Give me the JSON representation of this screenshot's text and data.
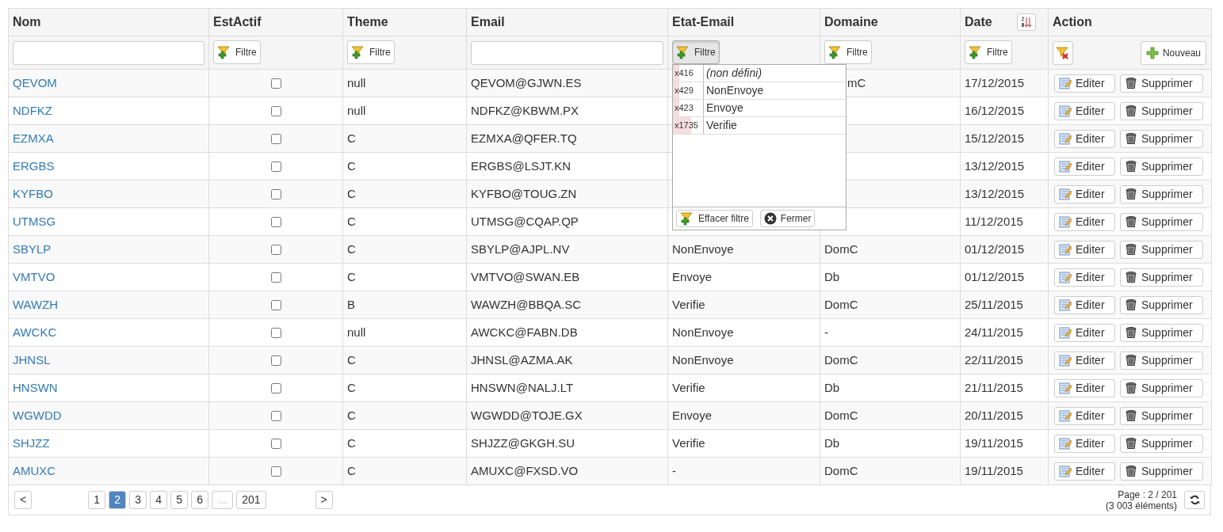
{
  "columns": [
    {
      "kind": "plain",
      "label": "Nom"
    },
    {
      "kind": "plain",
      "label": "EstActif"
    },
    {
      "kind": "plain",
      "label": "Theme"
    },
    {
      "kind": "plain",
      "label": "Email"
    },
    {
      "kind": "plain",
      "label": "Etat-Email"
    },
    {
      "kind": "plain",
      "label": "Domaine"
    },
    {
      "kind": "sortable",
      "label": "Date"
    },
    {
      "kind": "plain",
      "label": "Action"
    }
  ],
  "filters": [
    {
      "kind": "input"
    },
    {
      "kind": "button",
      "label": "Filtre",
      "active": false
    },
    {
      "kind": "button",
      "label": "Filtre",
      "active": false
    },
    {
      "kind": "input"
    },
    {
      "kind": "button",
      "label": "Filtre",
      "active": true
    },
    {
      "kind": "button",
      "label": "Filtre",
      "active": false
    },
    {
      "kind": "button",
      "label": "Filtre",
      "active": false
    },
    {
      "kind": "actions",
      "label": "Nouveau"
    }
  ],
  "rows": [
    {
      "nom": "QEVOM",
      "est_actif": false,
      "theme": "null",
      "email": "QEVOM@GJWN.ES",
      "domaine": "mC",
      "date": "17/12/2015",
      "actions": [
        "Editer",
        "Supprimer"
      ]
    },
    {
      "nom": "NDFKZ",
      "est_actif": false,
      "theme": "null",
      "email": "NDFKZ@KBWM.PX",
      "date": "16/12/2015",
      "actions": [
        "Editer",
        "Supprimer"
      ]
    },
    {
      "nom": "EZMXA",
      "est_actif": false,
      "theme": "C",
      "email": "EZMXA@QFER.TQ",
      "date": "15/12/2015",
      "actions": [
        "Editer",
        "Supprimer"
      ]
    },
    {
      "nom": "ERGBS",
      "est_actif": false,
      "theme": "C",
      "email": "ERGBS@LSJT.KN",
      "date": "13/12/2015",
      "actions": [
        "Editer",
        "Supprimer"
      ]
    },
    {
      "nom": "KYFBO",
      "est_actif": false,
      "theme": "C",
      "email": "KYFBO@TOUG.ZN",
      "date": "13/12/2015",
      "actions": [
        "Editer",
        "Supprimer"
      ]
    },
    {
      "nom": "UTMSG",
      "est_actif": false,
      "theme": "C",
      "email": "UTMSG@CQAP.QP",
      "date": "11/12/2015",
      "actions": [
        "Editer",
        "Supprimer"
      ]
    },
    {
      "nom": "SBYLP",
      "est_actif": false,
      "theme": "C",
      "email": "SBYLP@AJPL.NV",
      "etat_email": "NonEnvoye",
      "domaine": "DomC",
      "date": "01/12/2015",
      "actions": [
        "Editer",
        "Supprimer"
      ]
    },
    {
      "nom": "VMTVO",
      "est_actif": false,
      "theme": "C",
      "email": "VMTVO@SWAN.EB",
      "etat_email": "Envoye",
      "domaine": "Db",
      "date": "01/12/2015",
      "actions": [
        "Editer",
        "Supprimer"
      ]
    },
    {
      "nom": "WAWZH",
      "est_actif": false,
      "theme": "B",
      "email": "WAWZH@BBQA.SC",
      "etat_email": "Verifie",
      "domaine": "DomC",
      "date": "25/11/2015",
      "actions": [
        "Editer",
        "Supprimer"
      ]
    },
    {
      "nom": "AWCKC",
      "est_actif": false,
      "theme": "null",
      "email": "AWCKC@FABN.DB",
      "etat_email": "NonEnvoye",
      "domaine": "-",
      "date": "24/11/2015",
      "actions": [
        "Editer",
        "Supprimer"
      ]
    },
    {
      "nom": "JHNSL",
      "est_actif": false,
      "theme": "C",
      "email": "JHNSL@AZMA.AK",
      "etat_email": "NonEnvoye",
      "domaine": "DomC",
      "date": "22/11/2015",
      "actions": [
        "Editer",
        "Supprimer"
      ]
    },
    {
      "nom": "HNSWN",
      "est_actif": false,
      "theme": "C",
      "email": "HNSWN@NALJ.LT",
      "etat_email": "Verifie",
      "domaine": "Db",
      "date": "21/11/2015",
      "actions": [
        "Editer",
        "Supprimer"
      ]
    },
    {
      "nom": "WGWDD",
      "est_actif": false,
      "theme": "C",
      "email": "WGWDD@TOJE.GX",
      "etat_email": "Envoye",
      "domaine": "DomC",
      "date": "20/11/2015",
      "actions": [
        "Editer",
        "Supprimer"
      ]
    },
    {
      "nom": "SHJZZ",
      "est_actif": false,
      "theme": "C",
      "email": "SHJZZ@GKGH.SU",
      "etat_email": "Verifie",
      "domaine": "Db",
      "date": "19/11/2015",
      "actions": [
        "Editer",
        "Supprimer"
      ]
    },
    {
      "nom": "AMUXC",
      "est_actif": false,
      "theme": "C",
      "email": "AMUXC@FXSD.VO",
      "etat_email": "-",
      "domaine": "DomC",
      "date": "19/11/2015",
      "actions": [
        "Editer",
        "Supprimer"
      ]
    }
  ],
  "filter_popup": {
    "options": [
      {
        "kind": "undefined",
        "count": "x416",
        "label": "(non défini)",
        "level": 0.2
      },
      {
        "kind": "value",
        "count": "x429",
        "label": "NonEnvoye",
        "level": 0.2
      },
      {
        "kind": "value",
        "count": "x423",
        "label": "Envoye",
        "level": 0.2
      },
      {
        "kind": "value",
        "count": "x1735",
        "label": "Verifie",
        "level": 0.6
      }
    ],
    "buttons": [
      {
        "kind": "clear",
        "label": "Effacer filtre"
      },
      {
        "kind": "close",
        "label": "Fermer"
      }
    ]
  },
  "pagination": {
    "prev": "<",
    "next": ">",
    "pages": [
      {
        "label": "1",
        "selected": false,
        "disabled": false
      },
      {
        "label": "2",
        "selected": true,
        "disabled": false
      },
      {
        "label": "3",
        "selected": false,
        "disabled": false
      },
      {
        "label": "4",
        "selected": false,
        "disabled": false
      },
      {
        "label": "5",
        "selected": false,
        "disabled": false
      },
      {
        "label": "6",
        "selected": false,
        "disabled": false
      },
      {
        "label": "...",
        "selected": false,
        "disabled": true
      },
      {
        "label": "201",
        "selected": false,
        "disabled": false
      }
    ],
    "info": [
      "Page : 2 / 201",
      "(3 003 éléments)"
    ]
  }
}
